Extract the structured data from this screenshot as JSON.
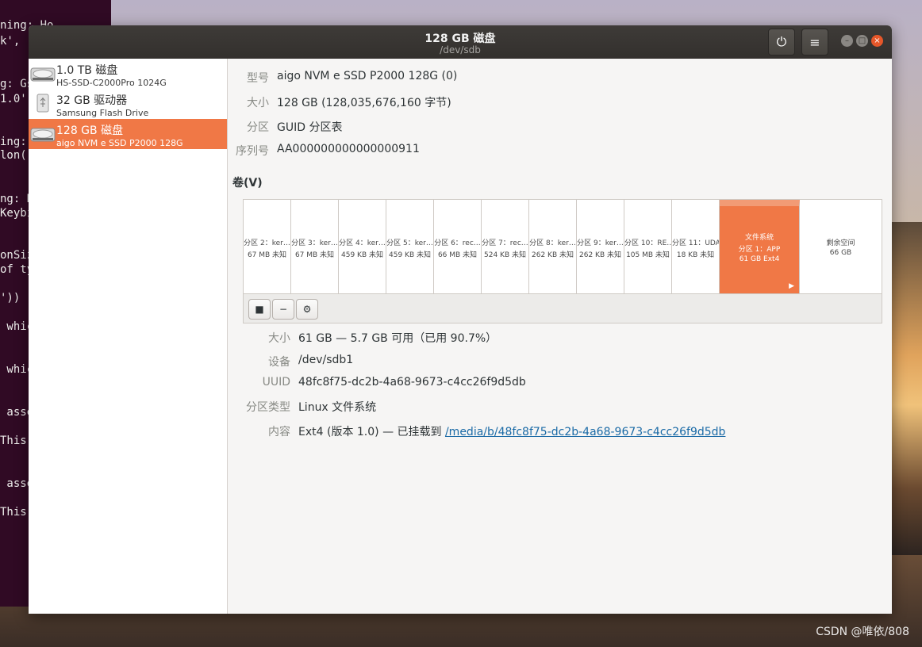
{
  "terminal": {
    "lines": [
      "ning: Ho",
      "k', '",
      "g: Gs",
      "1.0')",
      "ing:",
      "lon('",
      "ng: K",
      "Keybi",
      "onSiz",
      "of ty",
      "'))",
      " whic",
      " whic",
      " asse",
      "This",
      " asse",
      "This"
    ]
  },
  "watermark": "CSDN @唯依/808",
  "window": {
    "title": "128 GB 磁盘",
    "subtitle": "/dev/sdb",
    "buttons": {
      "power": "⏻",
      "menu": "≡",
      "minimize": "–",
      "maximize": "□",
      "close": "×"
    }
  },
  "sidebar": {
    "items": [
      {
        "title": "1.0 TB 磁盘",
        "subtitle": "HS-SSD-C2000Pro 1024G",
        "icon": "hard-disk-icon",
        "selected": false
      },
      {
        "title": "32 GB 驱动器",
        "subtitle": "Samsung Flash Drive",
        "icon": "usb-drive-icon",
        "selected": false
      },
      {
        "title": "128 GB 磁盘",
        "subtitle": "aigo NVM e SSD P2000 128G",
        "icon": "hard-disk-icon",
        "selected": true
      }
    ]
  },
  "drive_info": {
    "model_label": "型号",
    "model_value": "aigo NVM e SSD P2000 128G (0)",
    "size_label": "大小",
    "size_value": "128 GB (128,035,676,160 字节)",
    "partitioning_label": "分区",
    "partitioning_value": "GUID 分区表",
    "serial_label": "序列号",
    "serial_value": "AA000000000000000911"
  },
  "volumes": {
    "heading": "卷(V)",
    "partitions": [
      {
        "line1": "分区 2：ker…",
        "line2": "67 MB 未知"
      },
      {
        "line1": "分区 3：ker…",
        "line2": "67 MB 未知"
      },
      {
        "line1": "分区 4：ker…",
        "line2": "459 KB 未知"
      },
      {
        "line1": "分区 5：ker…",
        "line2": "459 KB 未知"
      },
      {
        "line1": "分区 6：rec…",
        "line2": "66 MB 未知"
      },
      {
        "line1": "分区 7：rec…",
        "line2": "524 KB 未知"
      },
      {
        "line1": "分区 8：ker…",
        "line2": "262 KB 未知"
      },
      {
        "line1": "分区 9：ker…",
        "line2": "262 KB 未知"
      },
      {
        "line1": "分区 10：RE…",
        "line2": "105 MB 未知"
      },
      {
        "line1": "分区 11：UDA",
        "line2": "18 KB 未知"
      }
    ],
    "selected_partition": {
      "line0": "文件系统",
      "line1": "分区 1：APP",
      "line2": "61 GB Ext4",
      "play": "▶"
    },
    "free_space": {
      "line1": "剩余空间",
      "line2": "66 GB"
    },
    "toolbar": {
      "stop": "■",
      "remove": "−",
      "settings": "⚙"
    }
  },
  "partition_details": {
    "size_label": "大小",
    "size_value": "61 GB — 5.7 GB 可用（已用 90.7%）",
    "device_label": "设备",
    "device_value": "/dev/sdb1",
    "uuid_label": "UUID",
    "uuid_value": "48fc8f75-dc2b-4a68-9673-c4cc26f9d5db",
    "type_label": "分区类型",
    "type_value": "Linux 文件系统",
    "contents_label": "内容",
    "contents_prefix": "Ext4 (版本 1.0) — 已挂载到 ",
    "contents_link": "/media/b/48fc8f75-dc2b-4a68-9673-c4cc26f9d5db"
  }
}
